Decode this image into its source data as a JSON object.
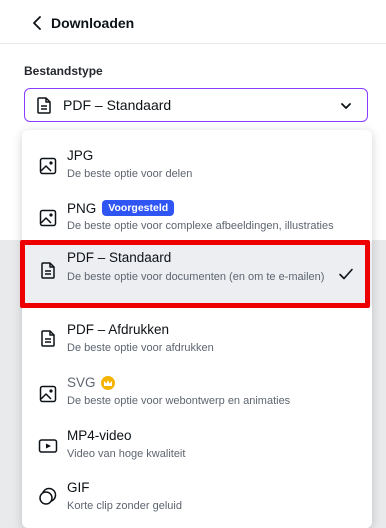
{
  "header": {
    "title": "Downloaden"
  },
  "field": {
    "label": "Bestandstype"
  },
  "select": {
    "value": "PDF – Standaard"
  },
  "options": [
    {
      "title": "JPG",
      "desc": "De beste optie voor delen",
      "icon": "image-icon"
    },
    {
      "title": "PNG",
      "badge": "Voorgesteld",
      "desc": "De beste optie voor complexe afbeeldingen, illustraties",
      "icon": "image-icon"
    },
    {
      "title": "PDF – Standaard",
      "desc": "De beste optie voor documenten (en om te e-mailen)",
      "icon": "document-icon",
      "selected": true
    },
    {
      "title": "PDF – Afdrukken",
      "desc": "De beste optie voor afdrukken",
      "icon": "document-icon"
    },
    {
      "title": "SVG",
      "desc": "De beste optie voor webontwerp en animaties",
      "icon": "image-icon",
      "premium": true
    },
    {
      "title": "MP4-video",
      "desc": "Video van hoge kwaliteit",
      "icon": "video-icon"
    },
    {
      "title": "GIF",
      "desc": "Korte clip zonder geluid",
      "icon": "gif-icon"
    }
  ],
  "colors": {
    "accent": "#8b3dff",
    "badge": "#2f56f4",
    "highlight": "#ee0000",
    "crown": "#f5b400"
  }
}
